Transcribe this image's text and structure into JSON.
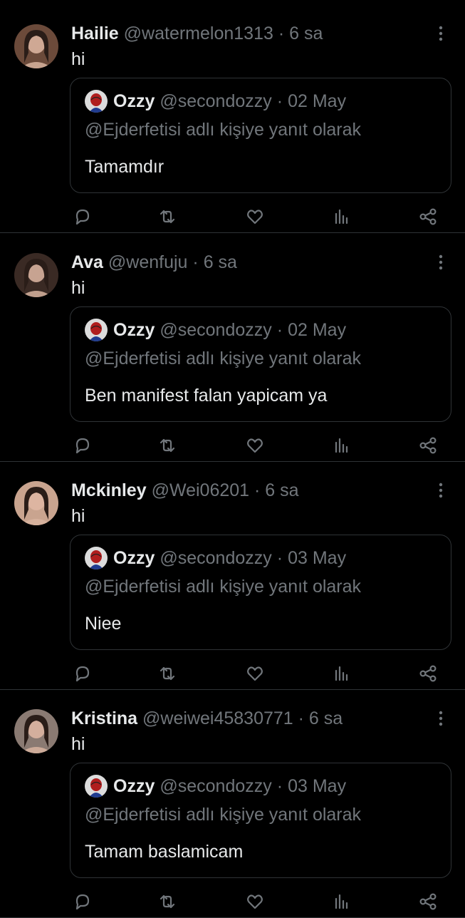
{
  "posts": [
    {
      "name": "Hailie",
      "handle": "@watermelon1313",
      "dot": "·",
      "time": "6 sa",
      "text": "hi",
      "avatar_color": "#6b4a3a",
      "quote": {
        "name": "Ozzy",
        "handle": "@secondozzy",
        "dot": "·",
        "date": "02 May",
        "reply_context": "@Ejderfetisi adlı kişiye yanıt olarak",
        "text": "Tamamdır"
      }
    },
    {
      "name": "Ava",
      "handle": "@wenfuju",
      "dot": "·",
      "time": "6 sa",
      "text": "hi",
      "avatar_color": "#3a2a24",
      "quote": {
        "name": "Ozzy",
        "handle": "@secondozzy",
        "dot": "·",
        "date": "02 May",
        "reply_context": "@Ejderfetisi adlı kişiye yanıt olarak",
        "text": "Ben manifest falan yapicam ya"
      }
    },
    {
      "name": "Mckinley",
      "handle": "@Wei06201",
      "dot": "·",
      "time": "6 sa",
      "text": "hi",
      "avatar_color": "#c9a48f",
      "quote": {
        "name": "Ozzy",
        "handle": "@secondozzy",
        "dot": "·",
        "date": "03 May",
        "reply_context": "@Ejderfetisi adlı kişiye yanıt olarak",
        "text": "Niee"
      }
    },
    {
      "name": "Kristina",
      "handle": "@weiwei45830771",
      "dot": "·",
      "time": "6 sa",
      "text": "hi",
      "avatar_color": "#8a7a72",
      "quote": {
        "name": "Ozzy",
        "handle": "@secondozzy",
        "dot": "·",
        "date": "03 May",
        "reply_context": "@Ejderfetisi adlı kişiye yanıt olarak",
        "text": "Tamam baslamicam"
      }
    }
  ],
  "icons": {
    "reply": "reply-icon",
    "repost": "repost-icon",
    "like": "heart-icon",
    "views": "views-icon",
    "share": "share-icon",
    "more": "more-icon"
  },
  "colors": {
    "background": "#000000",
    "primary_text": "#e7e9ea",
    "secondary_text": "#71767b",
    "border": "#2f3336",
    "quote_avatar": "#b01e1e"
  }
}
